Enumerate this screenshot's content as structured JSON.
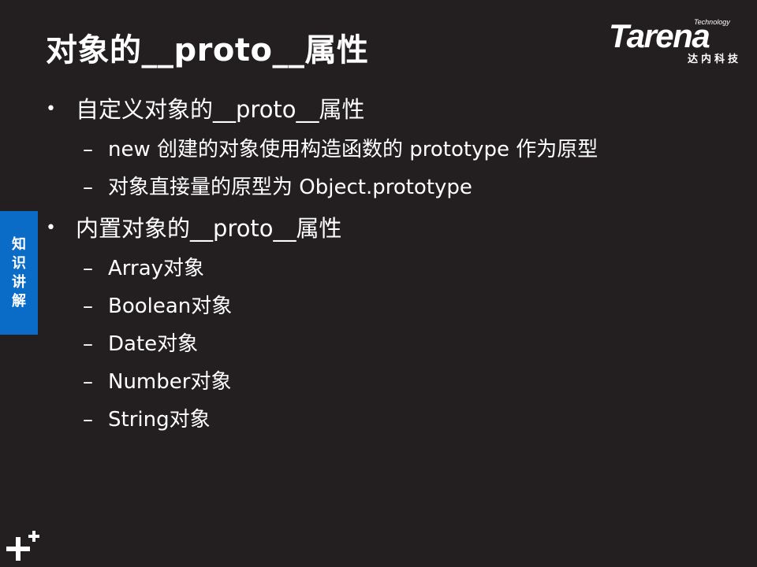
{
  "slide": {
    "title": "对象的__proto__属性",
    "logo": {
      "tagline": "Technology",
      "brand": "Tarena",
      "subtitle": "达内科技"
    },
    "side_tab": [
      "知",
      "识",
      "讲",
      "解"
    ],
    "bullet_char": "•",
    "dash_char": "–",
    "bullets": [
      {
        "text": "自定义对象的__proto__属性",
        "sub": [
          "new 创建的对象使用构造函数的 prototype 作为原型",
          "对象直接量的原型为 Object.prototype"
        ]
      },
      {
        "text": "内置对象的__proto__属性",
        "sub": [
          "Array对象",
          "Boolean对象",
          "Date对象",
          "Number对象",
          "String对象"
        ]
      }
    ]
  },
  "colors": {
    "background": "#231f20",
    "text": "#ffffff",
    "side_tab": "#0a6cc7"
  }
}
